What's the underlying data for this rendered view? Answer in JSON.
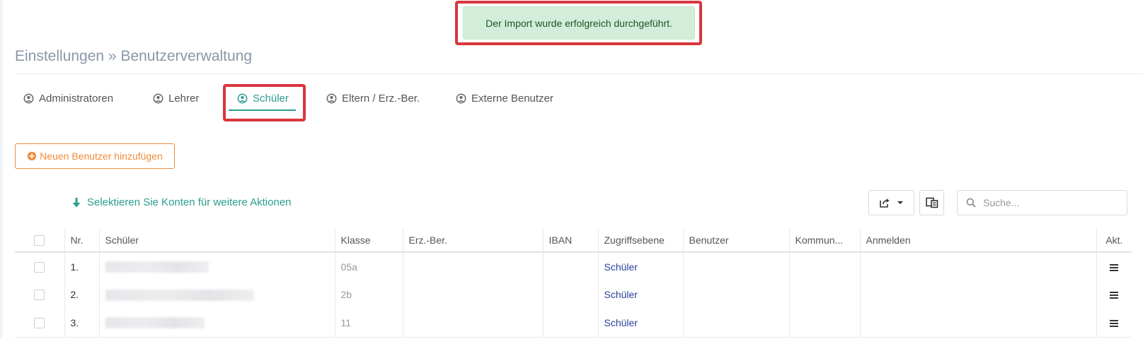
{
  "alert": {
    "message": "Der Import wurde erfolgreich durchgeführt."
  },
  "header": {
    "title": "Einstellungen » Benutzerverwaltung"
  },
  "tabs": [
    {
      "label": "Administratoren",
      "icon": "user-circle-icon",
      "active": false
    },
    {
      "label": "Lehrer",
      "icon": "user-circle-icon",
      "active": false
    },
    {
      "label": "Schüler",
      "icon": "user-circle-icon",
      "active": true
    },
    {
      "label": "Eltern / Erz.-Ber.",
      "icon": "user-circle-icon",
      "active": false
    },
    {
      "label": "Externe Benutzer",
      "icon": "user-circle-icon",
      "active": false
    }
  ],
  "actions": {
    "add_user_label": "Neuen Benutzer hinzufügen",
    "select_hint": "Selektieren Sie Konten für weitere Aktionen"
  },
  "search": {
    "placeholder": "Suche..."
  },
  "table": {
    "headers": [
      "Nr.",
      "Schüler",
      "Klasse",
      "Erz.-Ber.",
      "IBAN",
      "Zugriffsebene",
      "Benutzer",
      "Kommun...",
      "Anmelden",
      "Akt."
    ],
    "rows": [
      {
        "nr": "1.",
        "klasse": "05a",
        "zugriff": "Schüler"
      },
      {
        "nr": "2.",
        "klasse": "2b",
        "zugriff": "Schüler"
      },
      {
        "nr": "3.",
        "klasse": "11",
        "zugriff": "Schüler"
      }
    ]
  },
  "colors": {
    "accent": "#2a9d8f",
    "add_button": "#f08c3a",
    "alert_bg": "#d4edda",
    "alert_text": "#155724",
    "highlight": "#d9363e",
    "access_level": "#2a4199"
  }
}
